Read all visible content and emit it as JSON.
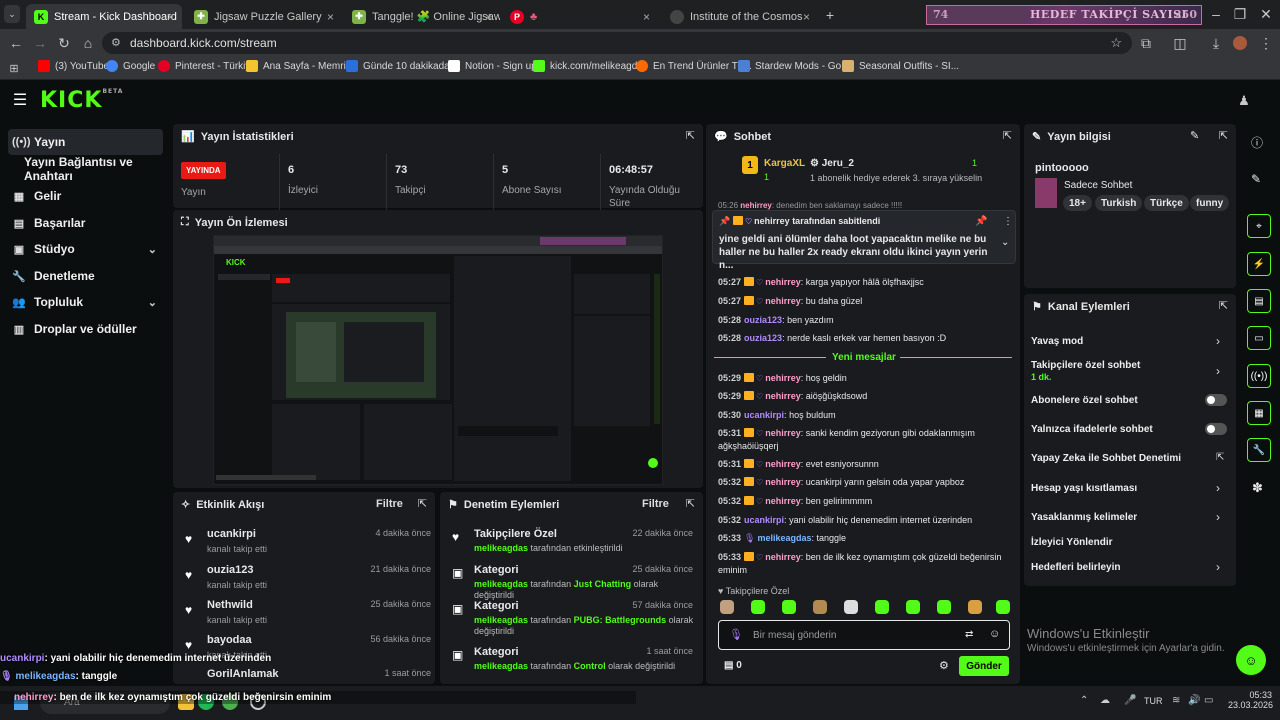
{
  "browser": {
    "tabs": [
      {
        "title": "Stream - Kick Dashboard",
        "active": true
      },
      {
        "title": "Jigsaw Puzzle Gallery"
      },
      {
        "title": "Tanggle! 🧩 Online Jigsaw Puzz"
      },
      {
        "title": "♣"
      },
      {
        "title": "Institute of the Cosmos"
      }
    ],
    "banner_text": "HEDEF TAKİPÇİ SAYISI",
    "banner_left": "74",
    "banner_right": "250",
    "url": "dashboard.kick.com/stream",
    "bookmarks": [
      "(3) YouTube",
      "Google",
      "Pinterest - Türkiye",
      "Ana Sayfa - Memrise",
      "Günde 10 dakikada...",
      "Notion - Sign up",
      "kick.com/melikeagd...",
      "En Trend Ürünler Tü...",
      "Stardew Mods - Go...",
      "Seasonal Outfits - SI..."
    ]
  },
  "kick": {
    "logo": "KICK",
    "beta": "BETA"
  },
  "sidebar": {
    "items": [
      {
        "label": "Yayın",
        "icon": "broadcast-icon",
        "active": true
      },
      {
        "label": "Yayın Bağlantısı ve Anahtarı",
        "icon": ""
      },
      {
        "label": "Gelir",
        "icon": "revenue-icon"
      },
      {
        "label": "Başarılar",
        "icon": "achievements-icon"
      },
      {
        "label": "Stüdyo",
        "icon": "studio-icon",
        "chevron": true
      },
      {
        "label": "Denetleme",
        "icon": "moderation-icon"
      },
      {
        "label": "Topluluk",
        "icon": "community-icon",
        "chevron": true
      },
      {
        "label": "Droplar ve ödüller",
        "icon": "drops-icon"
      }
    ]
  },
  "stats": {
    "title": "Yayın İstatistikleri",
    "live_badge": "YAYINDA",
    "columns": [
      {
        "value": "",
        "label": "Yayın"
      },
      {
        "value": "6",
        "label": "İzleyici"
      },
      {
        "value": "73",
        "label": "Takipçi"
      },
      {
        "value": "5",
        "label": "Abone Sayısı"
      },
      {
        "value": "06:48:57",
        "label": "Yayında Olduğu Süre"
      }
    ]
  },
  "preview": {
    "title": "Yayın Ön İzlemesi"
  },
  "activity": {
    "title": "Etkinlik Akışı",
    "filter": "Filtre",
    "items": [
      {
        "name": "ucankirpi",
        "sub": "kanalı takip etti",
        "time": "4 dakika önce"
      },
      {
        "name": "ouzia123",
        "sub": "kanalı takip etti",
        "time": "21 dakika önce"
      },
      {
        "name": "Nethwild",
        "sub": "kanalı takip etti",
        "time": "25 dakika önce"
      },
      {
        "name": "bayodaa",
        "sub": "kanalı takip etti",
        "time": "56 dakika önce"
      },
      {
        "name": "GorilAnlamak",
        "sub": "",
        "time": "1 saat önce"
      }
    ]
  },
  "moderation": {
    "title": "Denetim Eylemleri",
    "filter": "Filtre",
    "items": [
      {
        "title": "Takipçilere Özel",
        "user": "melikeagdas",
        "mid": "tarafından etkinleştirildi",
        "extra": "",
        "tail": "",
        "time": "22 dakika önce"
      },
      {
        "title": "Kategori",
        "user": "melikeagdas",
        "mid": "tarafından",
        "extra": "Just Chatting",
        "tail": "olarak değiştirildi",
        "time": "25 dakika önce"
      },
      {
        "title": "Kategori",
        "user": "melikeagdas",
        "mid": "tarafından",
        "extra": "PUBG: Battlegrounds",
        "tail": "olarak değiştirildi",
        "time": "57 dakika önce"
      },
      {
        "title": "Kategori",
        "user": "melikeagdas",
        "mid": "tarafından",
        "extra": "Control",
        "tail": "olarak değiştirildi",
        "time": "1 saat önce"
      }
    ]
  },
  "chat": {
    "title": "Sohbet",
    "top_user1": "KargaXL",
    "top_user1_count": "1",
    "top_user2": "Jeru_2",
    "top_user2_count": "1",
    "gift_text": "1 abonelik hediye ederek 3. sıraya yükselin",
    "partial_line": "denedim ben saklamayı sadece !!!!!",
    "pinned_by": "nehirrey tarafından sabitlendi",
    "pinned_text": "yine geldi ani ölümler daha loot yapacaktın melike ne bu haller ne bu haller 2x ready ekranı oldu ikinci yayın yerin n...",
    "new_messages": "Yeni mesajlar",
    "messages": [
      {
        "t": "05:27",
        "u": "nehirrey",
        "c": "pink",
        "m": "karga yapıyor hâlâ ölşfhaxjjsc"
      },
      {
        "t": "05:27",
        "u": "nehirrey",
        "c": "pink",
        "m": "bu daha güzel"
      },
      {
        "t": "05:28",
        "u": "ouzia123",
        "c": "purple",
        "m": "ben yazdım"
      },
      {
        "t": "05:28",
        "u": "ouzia123",
        "c": "purple",
        "m": "nerde kaslı erkek var hemen basıyon :D"
      },
      {
        "t": "05:29",
        "u": "nehirrey",
        "c": "pink",
        "m": "hoş geldin"
      },
      {
        "t": "05:29",
        "u": "nehirrey",
        "c": "pink",
        "m": "aiöşğüşkdsowd"
      },
      {
        "t": "05:30",
        "u": "ucankirpi",
        "c": "purple",
        "m": "hoş buldum"
      },
      {
        "t": "05:31",
        "u": "nehirrey",
        "c": "pink",
        "m": "sanki kendim geziyorun gibi odaklanmışım ağkşhaöiüşqerj"
      },
      {
        "t": "05:31",
        "u": "nehirrey",
        "c": "pink",
        "m": "evet esniyorsunnn"
      },
      {
        "t": "05:32",
        "u": "nehirrey",
        "c": "pink",
        "m": "ucankirpi yarın gelsin oda yapar yapboz"
      },
      {
        "t": "05:32",
        "u": "nehirrey",
        "c": "pink",
        "m": "ben gelirimmmm"
      },
      {
        "t": "05:32",
        "u": "ucankirpi",
        "c": "purple",
        "m": "yani olabilir hiç denemedim internet üzerinden"
      },
      {
        "t": "05:33",
        "u": "melikeagdas",
        "c": "blue",
        "m": "tanggle"
      },
      {
        "t": "05:33",
        "u": "nehirrey",
        "c": "pink",
        "m": "ben de ilk kez oynamıştım çok güzeldi beğenirsin eminim"
      }
    ],
    "followers_only": "Takipçilere Özel",
    "input_placeholder": "Bir mesaj gönderin",
    "points": "0",
    "send": "Gönder"
  },
  "stream_info": {
    "title": "Yayın bilgisi",
    "channel": "pintooooo",
    "stream_title": "Sadece Sohbet",
    "tags": [
      "18+",
      "Turkish",
      "Türkçe",
      "funny"
    ]
  },
  "channel_actions": {
    "title": "Kanal Eylemleri",
    "items": [
      {
        "label": "Yavaş mod",
        "type": "chevron"
      },
      {
        "label": "Takipçilere özel sohbet",
        "sub": "1 dk.",
        "type": "chevron"
      },
      {
        "label": "Abonelere özel sohbet",
        "type": "toggle"
      },
      {
        "label": "Yalnızca ifadelerle sohbet",
        "type": "toggle"
      },
      {
        "label": "Yapay Zeka ile Sohbet Denetimi",
        "type": "external"
      },
      {
        "label": "Hesap yaşı kısıtlaması",
        "type": "chevron"
      },
      {
        "label": "Yasaklanmış kelimeler",
        "type": "chevron"
      },
      {
        "label": "İzleyici Yönlendir",
        "type": "none"
      },
      {
        "label": "Hedefleri belirleyin",
        "type": "chevron"
      }
    ]
  },
  "windows_activate": {
    "title": "Windows'u Etkinleştir",
    "sub": "Windows'u etkinleştirmek için Ayarlar'a gidin."
  },
  "overlay_chat": [
    {
      "user": "ucankirpi",
      "msg": ": yani olabilir hiç denemedim internet üzerinden"
    },
    {
      "user": "melikeagdas",
      "msg": ": tanggle"
    },
    {
      "user": "nehirrey",
      "msg": ": ben de ilk kez oynamıştım çok güzeldi beğenirsin eminim"
    }
  ],
  "taskbar": {
    "search": "Ara",
    "lang": "TUR",
    "time": "05:33",
    "date": "23.03.2026"
  }
}
